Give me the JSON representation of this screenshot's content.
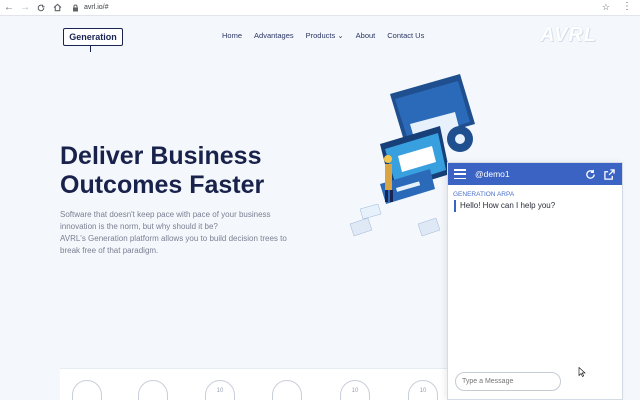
{
  "browser": {
    "url": "avrl.io/#",
    "back_icon": "arrow-left-icon",
    "forward_icon": "arrow-right-icon",
    "reload_icon": "reload-icon",
    "home_icon": "home-icon"
  },
  "site": {
    "logo_text": "Generation",
    "nav": [
      "Home",
      "Advantages",
      "Products",
      "About",
      "Contact Us"
    ],
    "products_caret": "⌄",
    "brand": "AVRL"
  },
  "hero": {
    "title_line1": "Deliver Business",
    "title_line2": "Outcomes Faster",
    "text_line1": "Software that doesn't keep pace with pace of your business",
    "text_line2": "innovation is the norm, but why should it be?",
    "text_line3": "AVRL's Generation platform allows you to build decision trees to",
    "text_line4": "break free of that paradigm."
  },
  "badges": [
    "10",
    "10",
    "10"
  ],
  "chat": {
    "user": "@demo1",
    "sender": "GENERATION ARPA",
    "message": "Hello! How can I help you?",
    "input_placeholder": "Type a Message"
  },
  "colors": {
    "accent": "#3b63c4",
    "heading": "#18224b",
    "background": "#f4f8fc"
  }
}
